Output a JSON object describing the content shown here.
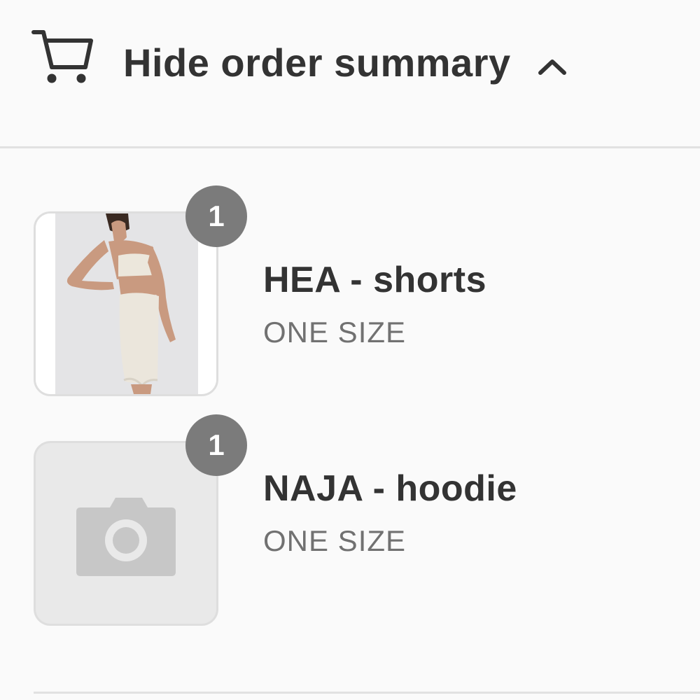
{
  "header": {
    "toggle_label": "Hide order summary",
    "cart_icon": "cart-icon",
    "chevron_icon": "chevron-up-icon"
  },
  "line_items": [
    {
      "name": "HEA - shorts",
      "variant": "ONE SIZE",
      "quantity": "1",
      "image": "product-photo"
    },
    {
      "name": "NAJA - hoodie",
      "variant": "ONE SIZE",
      "quantity": "1",
      "image": "camera-placeholder-icon"
    }
  ],
  "colors": {
    "text": "#333333",
    "muted_text": "#717171",
    "badge": "#7b7b7b",
    "background": "#fafafa",
    "divider": "#e1e1e1"
  }
}
